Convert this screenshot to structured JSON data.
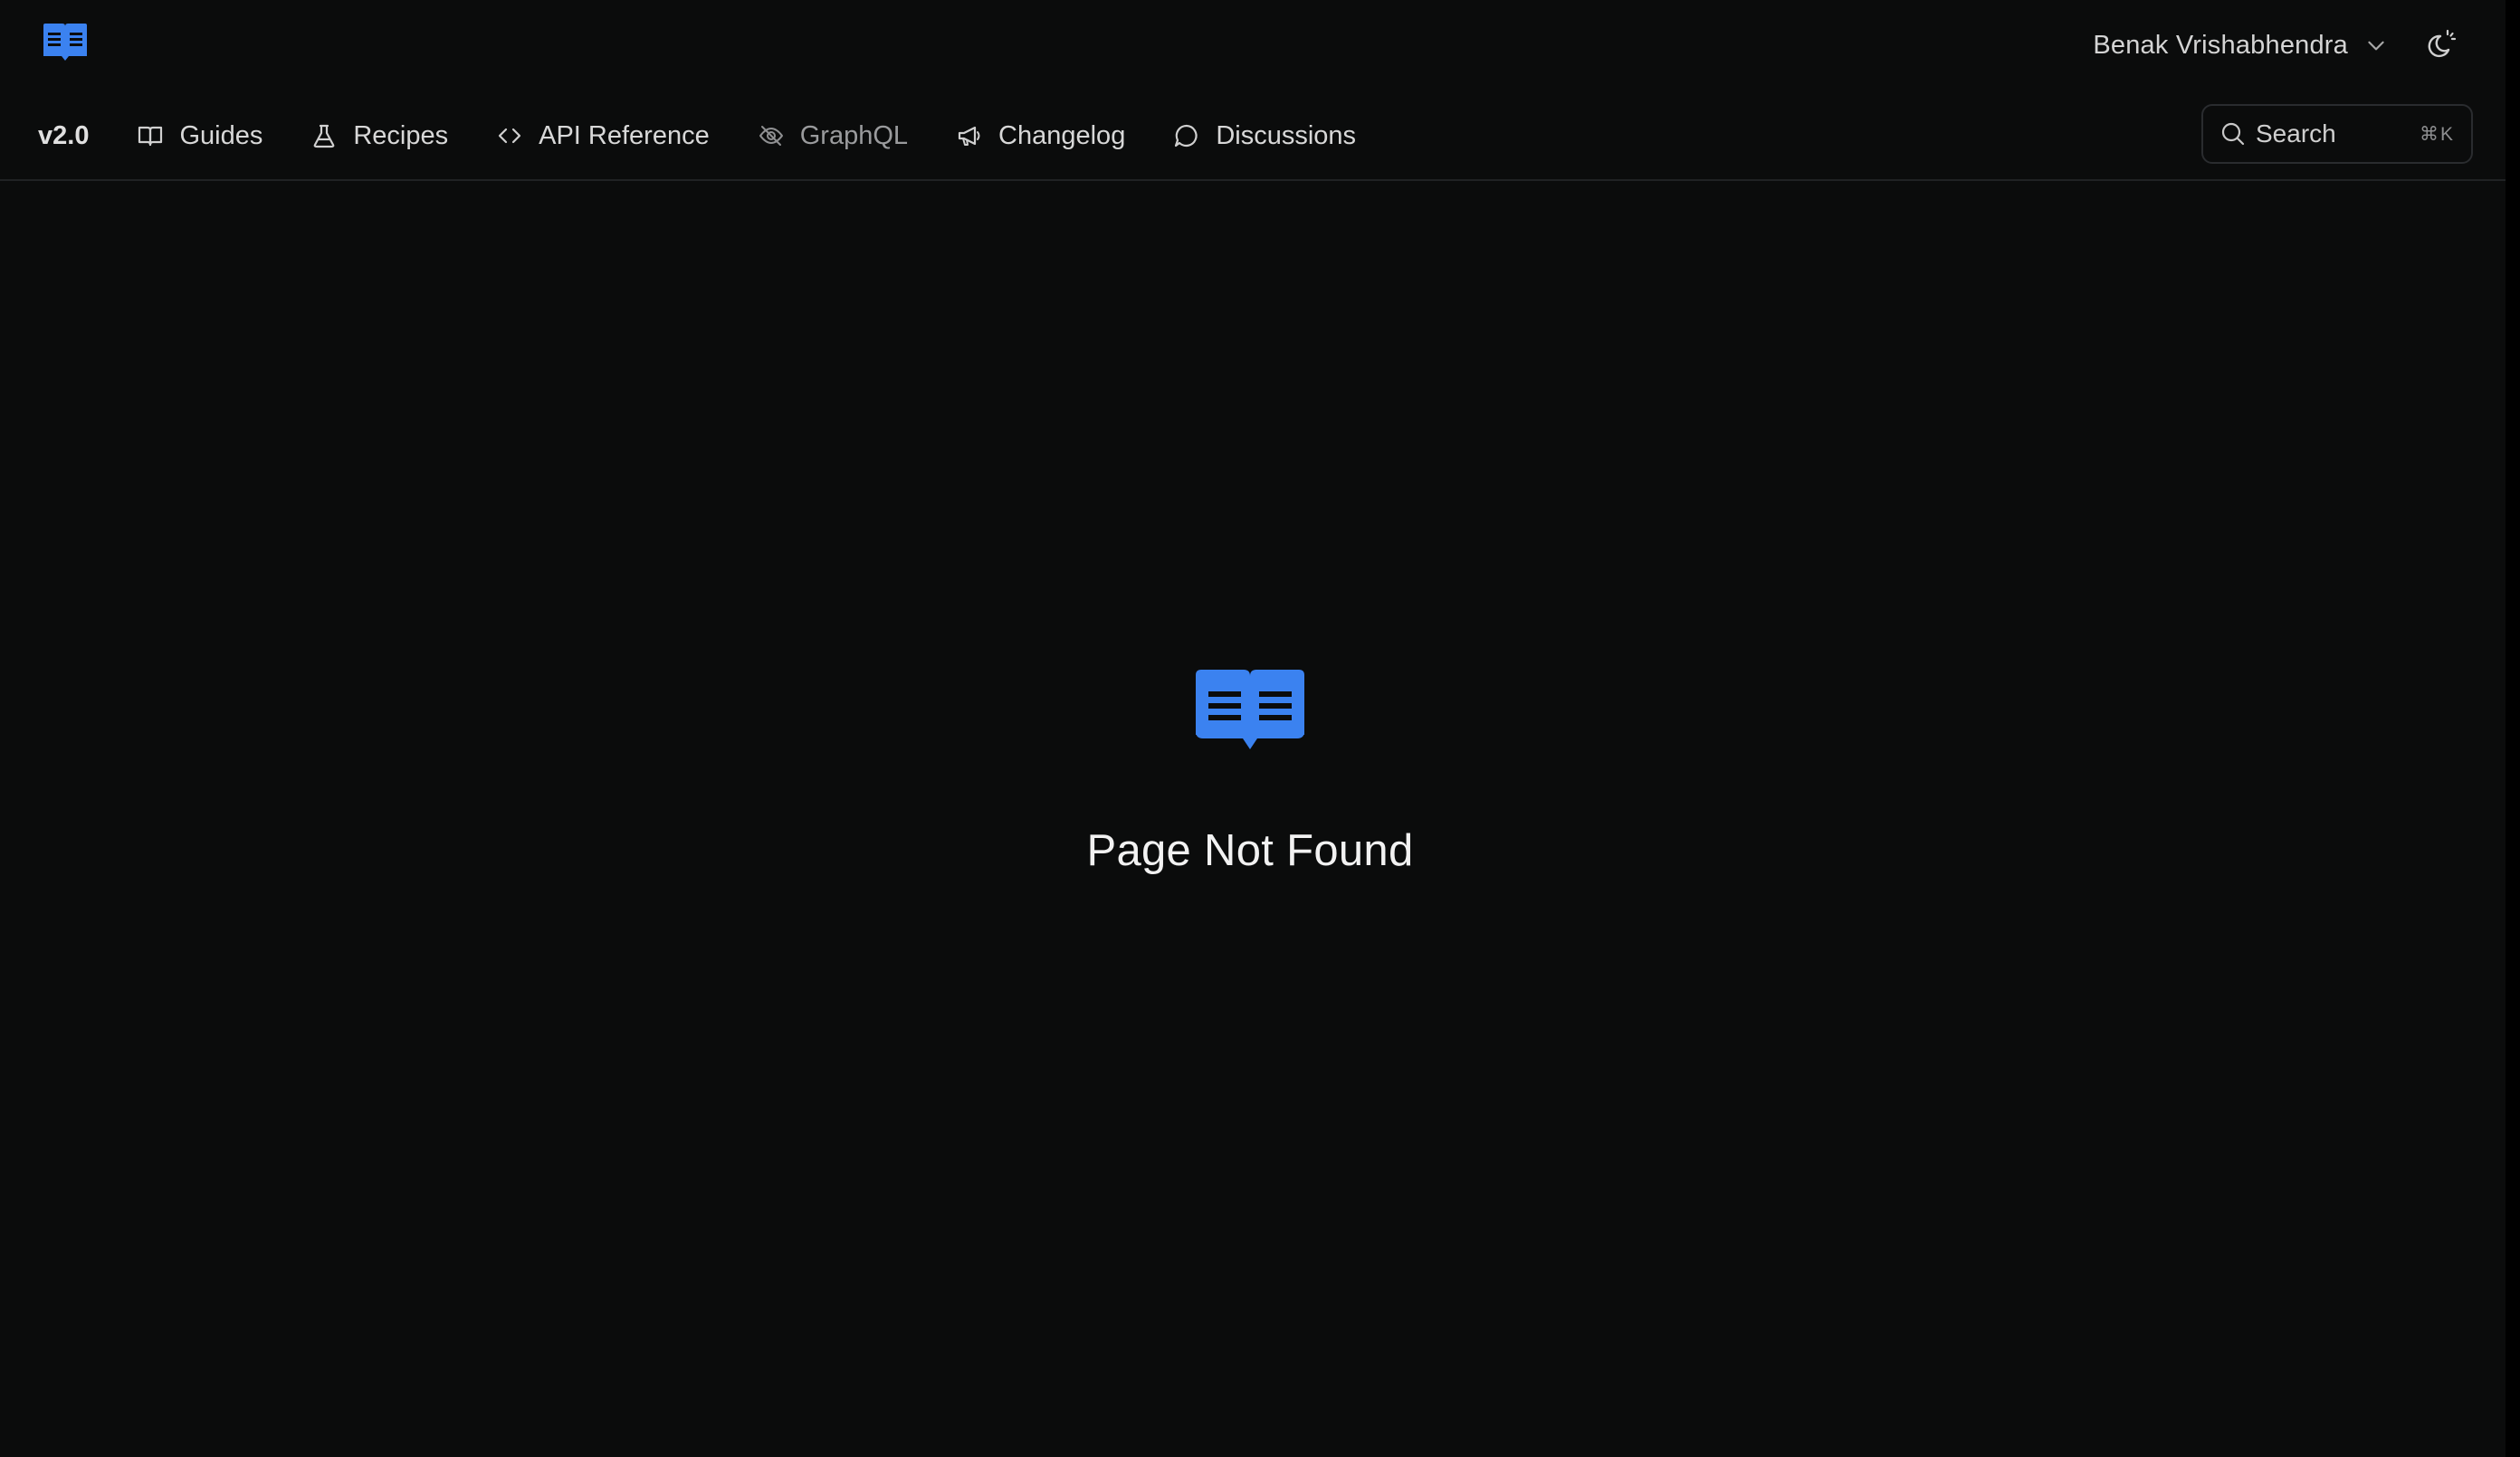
{
  "header": {
    "logo_icon": "book-open-icon",
    "user_name": "Benak Vrishabhendra",
    "user_menu_icon": "chevron-down-icon",
    "theme_toggle_icon": "moon-sun-icon"
  },
  "nav": {
    "version": "v2.0",
    "items": [
      {
        "label": "Guides",
        "icon": "book-icon"
      },
      {
        "label": "Recipes",
        "icon": "flask-icon"
      },
      {
        "label": "API Reference",
        "icon": "code-brackets-icon"
      },
      {
        "label": "GraphQL",
        "icon": "eye-off-icon"
      },
      {
        "label": "Changelog",
        "icon": "megaphone-icon"
      },
      {
        "label": "Discussions",
        "icon": "chat-bubble-icon"
      }
    ],
    "search": {
      "label": "Search",
      "shortcut": "⌘K"
    }
  },
  "main": {
    "icon": "book-open-icon",
    "title": "Page Not Found"
  },
  "colors": {
    "background": "#0b0c0c",
    "accent": "#3b82f0",
    "text": "#e6e6e6",
    "muted": "#9a9b9d",
    "border": "#202224"
  }
}
